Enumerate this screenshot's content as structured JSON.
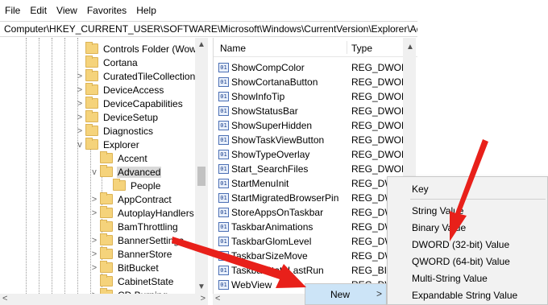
{
  "menu": [
    "File",
    "Edit",
    "View",
    "Favorites",
    "Help"
  ],
  "address": "Computer\\HKEY_CURRENT_USER\\SOFTWARE\\Microsoft\\Windows\\CurrentVersion\\Explorer\\Advanced",
  "tree": [
    {
      "label": "Controls Folder (Wow",
      "chev": ""
    },
    {
      "label": "Cortana",
      "chev": ""
    },
    {
      "label": "CuratedTileCollection",
      "chev": ">"
    },
    {
      "label": "DeviceAccess",
      "chev": ">"
    },
    {
      "label": "DeviceCapabilities",
      "chev": ">"
    },
    {
      "label": "DeviceSetup",
      "chev": ">"
    },
    {
      "label": "Diagnostics",
      "chev": ">"
    },
    {
      "label": "Explorer",
      "chev": "v"
    },
    {
      "label": "Accent",
      "chev": ""
    },
    {
      "label": "Advanced",
      "chev": "v"
    },
    {
      "label": "People",
      "chev": ""
    },
    {
      "label": "AppContract",
      "chev": ">"
    },
    {
      "label": "AutoplayHandlers",
      "chev": ">"
    },
    {
      "label": "BamThrottling",
      "chev": ""
    },
    {
      "label": "BannerSettings",
      "chev": ">"
    },
    {
      "label": "BannerStore",
      "chev": ">"
    },
    {
      "label": "BitBucket",
      "chev": ">"
    },
    {
      "label": "CabinetState",
      "chev": ""
    },
    {
      "label": "CD Burning",
      "chev": ">"
    }
  ],
  "columns": {
    "name": "Name",
    "type": "Type"
  },
  "values": [
    {
      "name": "ShowCompColor",
      "type": "REG_DWORD"
    },
    {
      "name": "ShowCortanaButton",
      "type": "REG_DWORD"
    },
    {
      "name": "ShowInfoTip",
      "type": "REG_DWORD"
    },
    {
      "name": "ShowStatusBar",
      "type": "REG_DWORD"
    },
    {
      "name": "ShowSuperHidden",
      "type": "REG_DWORD"
    },
    {
      "name": "ShowTaskViewButton",
      "type": "REG_DWORD"
    },
    {
      "name": "ShowTypeOverlay",
      "type": "REG_DWORD"
    },
    {
      "name": "Start_SearchFiles",
      "type": "REG_DWORD"
    },
    {
      "name": "StartMenuInit",
      "type": "REG_DWOR"
    },
    {
      "name": "StartMigratedBrowserPin",
      "type": "REG_DW"
    },
    {
      "name": "StoreAppsOnTaskbar",
      "type": "REG_DW"
    },
    {
      "name": "TaskbarAnimations",
      "type": "REG_DW"
    },
    {
      "name": "TaskbarGlomLevel",
      "type": "REG_DW"
    },
    {
      "name": "TaskbarSizeMove",
      "type": "REG_DW"
    },
    {
      "name": "TaskbarStateLastRun",
      "type": "REG_BIN"
    },
    {
      "name": "WebView",
      "type": "REG_DW"
    }
  ],
  "context_new": {
    "label": "New",
    "arrow": ">"
  },
  "context_items": [
    "Key",
    "String Value",
    "Binary Value",
    "DWORD (32-bit) Value",
    "QWORD (64-bit) Value",
    "Multi-String Value",
    "Expandable String Value"
  ],
  "icons": {
    "reg_value": "reg-dword-icon",
    "folder": "folder-icon"
  },
  "colors": {
    "arrow": "#e8201a",
    "highlight": "#cce4f7",
    "folder": "#f5d37b"
  }
}
